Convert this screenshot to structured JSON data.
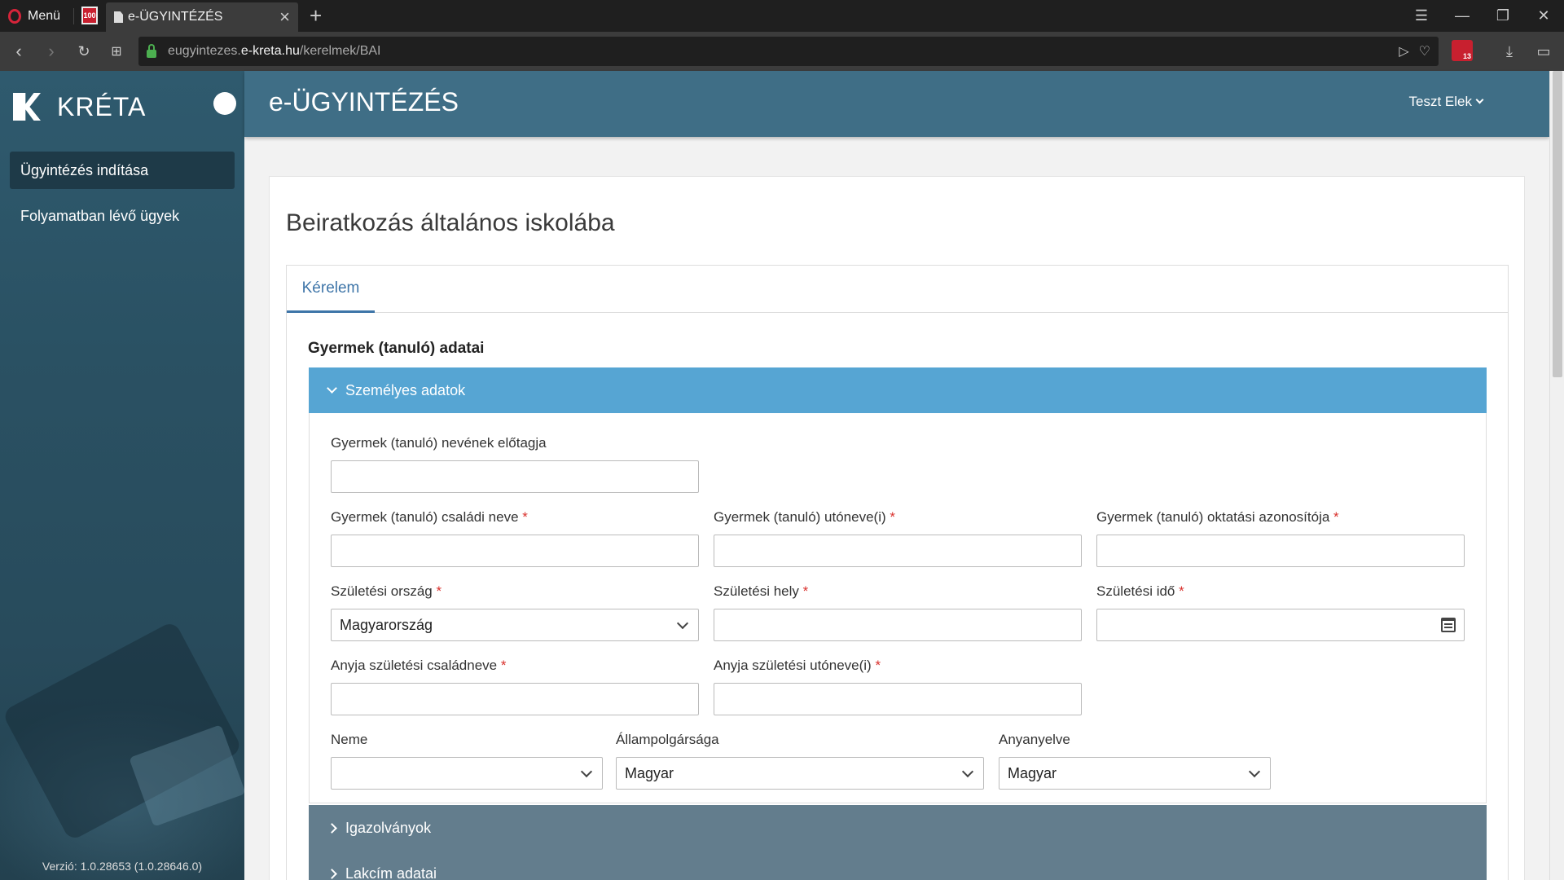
{
  "browser": {
    "menu_label": "Menü",
    "tab_title": "e-ÜGYINTÉZÉS",
    "url_prefix": "eugyintezes.",
    "url_host": "e-kreta.hu",
    "url_path": "/kerelmek/BAI",
    "extension_badge": "13"
  },
  "sidebar": {
    "brand": "KRÉTA",
    "items": [
      {
        "label": "Ügyintézés indítása",
        "active": true
      },
      {
        "label": "Folyamatban lévő ügyek",
        "active": false
      }
    ],
    "version": "Verzió: 1.0.28653 (1.0.28646.0)"
  },
  "header": {
    "title": "e-ÜGYINTÉZÉS",
    "user": "Teszt Elek"
  },
  "page": {
    "title": "Beiratkozás általános iskolába",
    "tab_label": "Kérelem",
    "section_title": "Gyermek (tanuló) adatai"
  },
  "accordion": {
    "personal": "Személyes adatok",
    "certificates": "Igazolványok",
    "address": "Lakcím adatai"
  },
  "form": {
    "name_prefix": {
      "label": "Gyermek (tanuló) nevének előtagja",
      "required": false,
      "value": ""
    },
    "family_name": {
      "label": "Gyermek (tanuló) családi neve",
      "required": true,
      "value": ""
    },
    "given_name": {
      "label": "Gyermek (tanuló) utóneve(i)",
      "required": true,
      "value": ""
    },
    "edu_id": {
      "label": "Gyermek (tanuló) oktatási azonosítója",
      "required": true,
      "value": ""
    },
    "birth_country": {
      "label": "Születési ország",
      "required": true,
      "value": "Magyarország"
    },
    "birth_place": {
      "label": "Születési hely",
      "required": true,
      "value": ""
    },
    "birth_date": {
      "label": "Születési idő",
      "required": true,
      "value": ""
    },
    "mother_family": {
      "label": "Anyja születési családneve",
      "required": true,
      "value": ""
    },
    "mother_given": {
      "label": "Anyja születési utóneve(i)",
      "required": true,
      "value": ""
    },
    "gender": {
      "label": "Neme",
      "required": false,
      "value": ""
    },
    "citizenship": {
      "label": "Állampolgársága",
      "required": false,
      "value": "Magyar"
    },
    "mother_tongue": {
      "label": "Anyanyelve",
      "required": false,
      "value": "Magyar"
    },
    "required_mark": "*"
  },
  "colors": {
    "header": "#3f6e86",
    "accordion_open": "#56a5d3",
    "accordion_closed": "#637d8d",
    "tab_active": "#3e75a8",
    "required": "#d9302c"
  }
}
